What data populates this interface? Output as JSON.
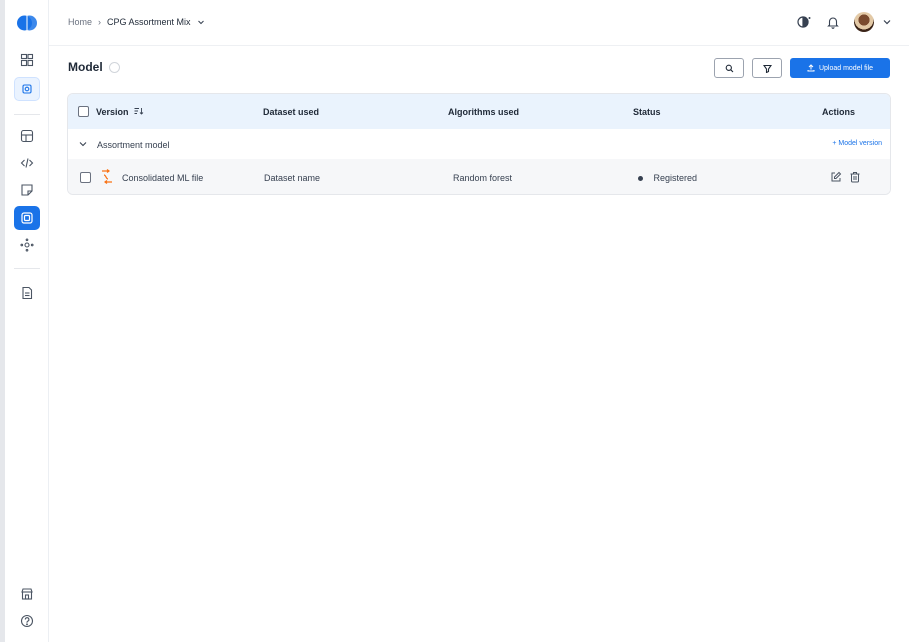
{
  "breadcrumb": {
    "home": "Home",
    "current": "CPG Assortment Mix"
  },
  "page": {
    "title": "Model"
  },
  "toolbar": {
    "upload_label": "Upload model file"
  },
  "table": {
    "columns": [
      "Version",
      "Dataset used",
      "Algorithms used",
      "Status",
      "Actions"
    ],
    "group": {
      "name": "Assortment model",
      "add_label": "+ Model version"
    },
    "rows": [
      {
        "version": "Consolidated ML file",
        "dataset": "Dataset name",
        "algorithm": "Random forest",
        "status": "Registered"
      }
    ]
  },
  "icons": {
    "logo": "logo-icon",
    "sidebar": [
      "dashboard-icon",
      "settings-chip-icon",
      "layout-icon",
      "code-icon",
      "note-icon",
      "model-icon",
      "hub-icon",
      "report-icon",
      "store-icon",
      "help-icon"
    ],
    "topbar": [
      "theme-toggle-icon",
      "bell-icon",
      "avatar",
      "chevron-down-icon"
    ],
    "toolbar": [
      "search-icon",
      "filter-icon",
      "upload-icon"
    ],
    "row": [
      "file-icon",
      "edit-icon",
      "delete-icon"
    ]
  },
  "colors": {
    "accent": "#1a73e8",
    "header_bg": "#eaf3fd",
    "row_bg": "#f6f7f9"
  }
}
